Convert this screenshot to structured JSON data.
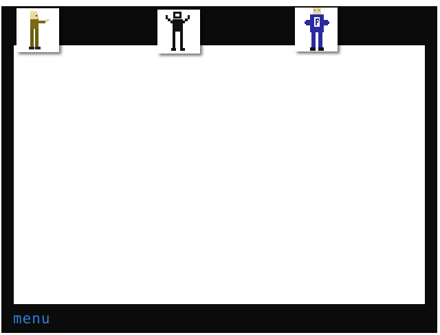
{
  "characters": [
    {
      "icon": "pointing-man-icon",
      "color": "#7a6a16"
    },
    {
      "icon": "arms-raised-figure-icon",
      "color": "#111111"
    },
    {
      "icon": "p-suit-figure-icon",
      "color": "#2c2aa0"
    }
  ],
  "menu": {
    "label": "menu",
    "color": "#2f7fdc"
  },
  "colors": {
    "frame": "#0b0b0b",
    "canvas": "#ffffff"
  }
}
